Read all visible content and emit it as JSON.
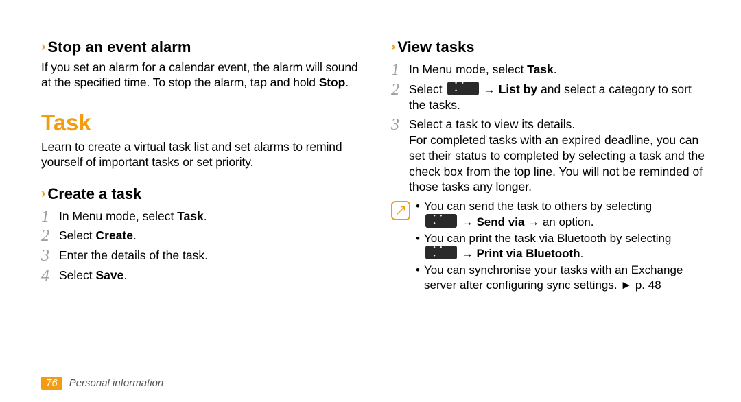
{
  "left": {
    "stop_alarm": {
      "heading": "Stop an event alarm",
      "body_parts": [
        "If you set an alarm for a calendar event, the alarm will sound at the specified time. To stop the alarm, tap and hold ",
        "Stop",
        "."
      ]
    },
    "task_heading": "Task",
    "task_intro": "Learn to create a virtual task list and set alarms to remind yourself of important tasks or set priority.",
    "create": {
      "heading": "Create a task",
      "steps": {
        "n1": "1",
        "s1_a": "In Menu mode, select ",
        "s1_b": "Task",
        "s1_c": ".",
        "n2": "2",
        "s2_a": "Select ",
        "s2_b": "Create",
        "s2_c": ".",
        "n3": "3",
        "s3": "Enter the details of the task.",
        "n4": "4",
        "s4_a": "Select ",
        "s4_b": "Save",
        "s4_c": "."
      }
    }
  },
  "right": {
    "view": {
      "heading": "View tasks",
      "steps": {
        "n1": "1",
        "s1_a": "In Menu mode, select ",
        "s1_b": "Task",
        "s1_c": ".",
        "n2": "2",
        "s2_a": "Select ",
        "s2_b": " → ",
        "s2_c": "List by",
        "s2_d": " and select a category to sort the tasks.",
        "n3": "3",
        "s3": "Select a task to view its details.",
        "s3_extra": "For completed tasks with an expired deadline, you can set their status to completed by selecting a task and the check box from the top line. You will not be reminded of those tasks any longer."
      },
      "note": {
        "b1_a": "You can send the task to others by selecting ",
        "b1_b": " → ",
        "b1_c": "Send via",
        "b1_d": " → an option.",
        "b2_a": "You can print the task via Bluetooth by selecting ",
        "b2_b": " → ",
        "b2_c": "Print via Bluetooth",
        "b2_d": ".",
        "b3": "You can synchronise your tasks with an Exchange server after configuring sync settings. ► p. 48"
      }
    }
  },
  "footer": {
    "page": "76",
    "section": "Personal information"
  }
}
